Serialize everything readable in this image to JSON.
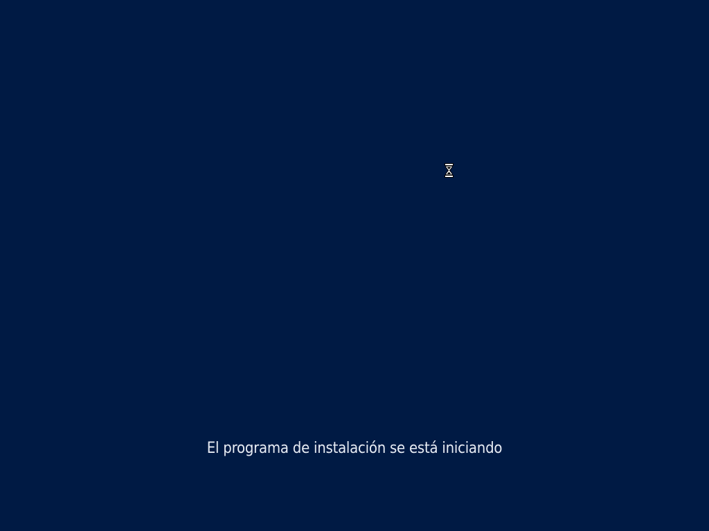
{
  "screen": {
    "background_color": "#001a44",
    "status_text": "El programa de instalación se está iniciando",
    "status_text_color": "#e8ecf4"
  },
  "cursor": {
    "icon": "hourglass-icon"
  }
}
